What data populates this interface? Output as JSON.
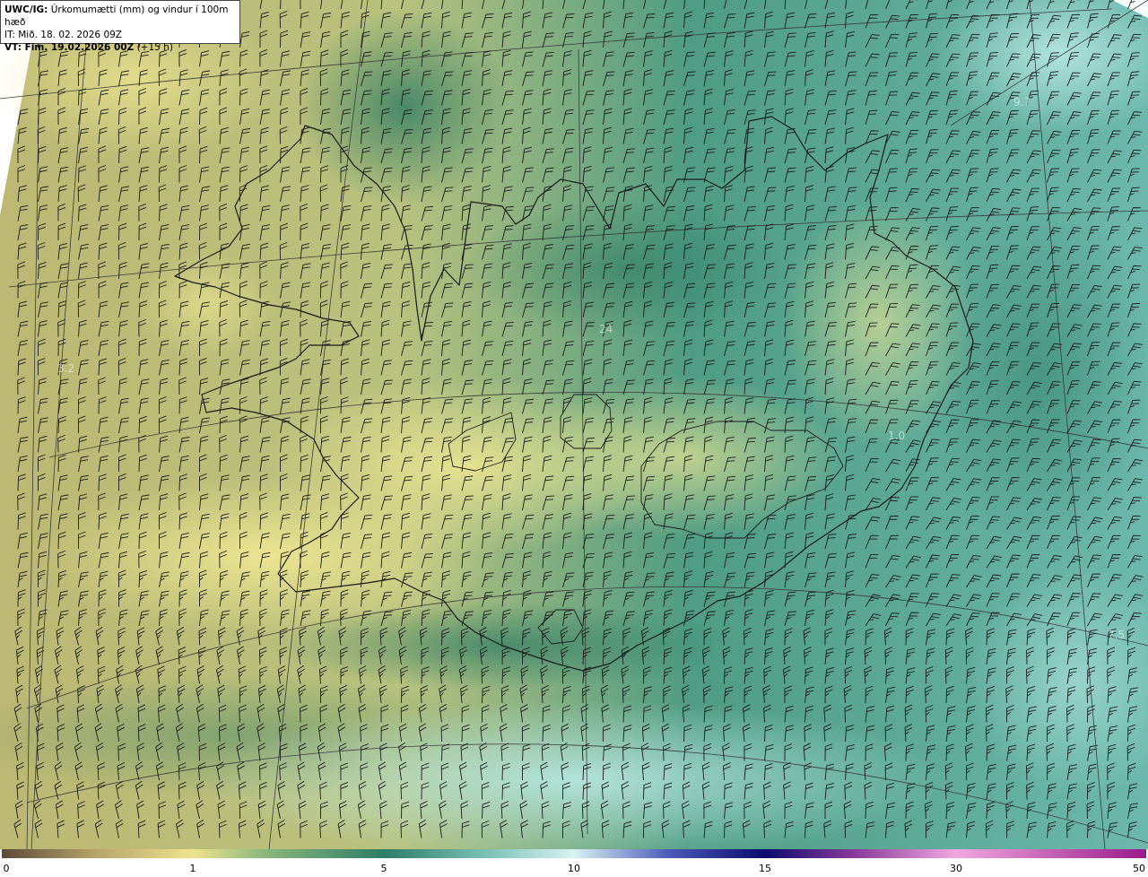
{
  "header": {
    "line1_bold": "UWC/IG:",
    "line1_rest": " Úrkomumætti (mm) og vindur í 100m hæð",
    "line2": "IT: Mið. 18. 02. 2026 09Z",
    "line3_bold": "VT: Fim. 19.02.2026 00Z",
    "line3_rest": " (+15 h)"
  },
  "map_labels": [
    "24",
    "3.2",
    "7.5",
    "9.7",
    "1.0"
  ],
  "colorbar": {
    "ticks": [
      "0",
      "1",
      "5",
      "10",
      "15",
      "30",
      "50"
    ],
    "tick_values": [
      0,
      1,
      5,
      10,
      15,
      30,
      50
    ],
    "stops": [
      {
        "v": 0,
        "c": "#5c4a3a"
      },
      {
        "v": 0.5,
        "c": "#b8a56a"
      },
      {
        "v": 1,
        "c": "#efe38e"
      },
      {
        "v": 2.5,
        "c": "#8ab87c"
      },
      {
        "v": 5,
        "c": "#2e7d66"
      },
      {
        "v": 7.5,
        "c": "#74bcb2"
      },
      {
        "v": 10,
        "c": "#d6f3f3"
      },
      {
        "v": 12.5,
        "c": "#4a5ab8"
      },
      {
        "v": 15,
        "c": "#0b0a6e"
      },
      {
        "v": 22,
        "c": "#8a3a9a"
      },
      {
        "v": 30,
        "c": "#f0a8e0"
      },
      {
        "v": 50,
        "c": "#9a1a8a"
      }
    ]
  },
  "colors": {
    "coast": "#1a1a1a",
    "grid": "#3a3a3a",
    "barb": "#1a1a1a"
  }
}
